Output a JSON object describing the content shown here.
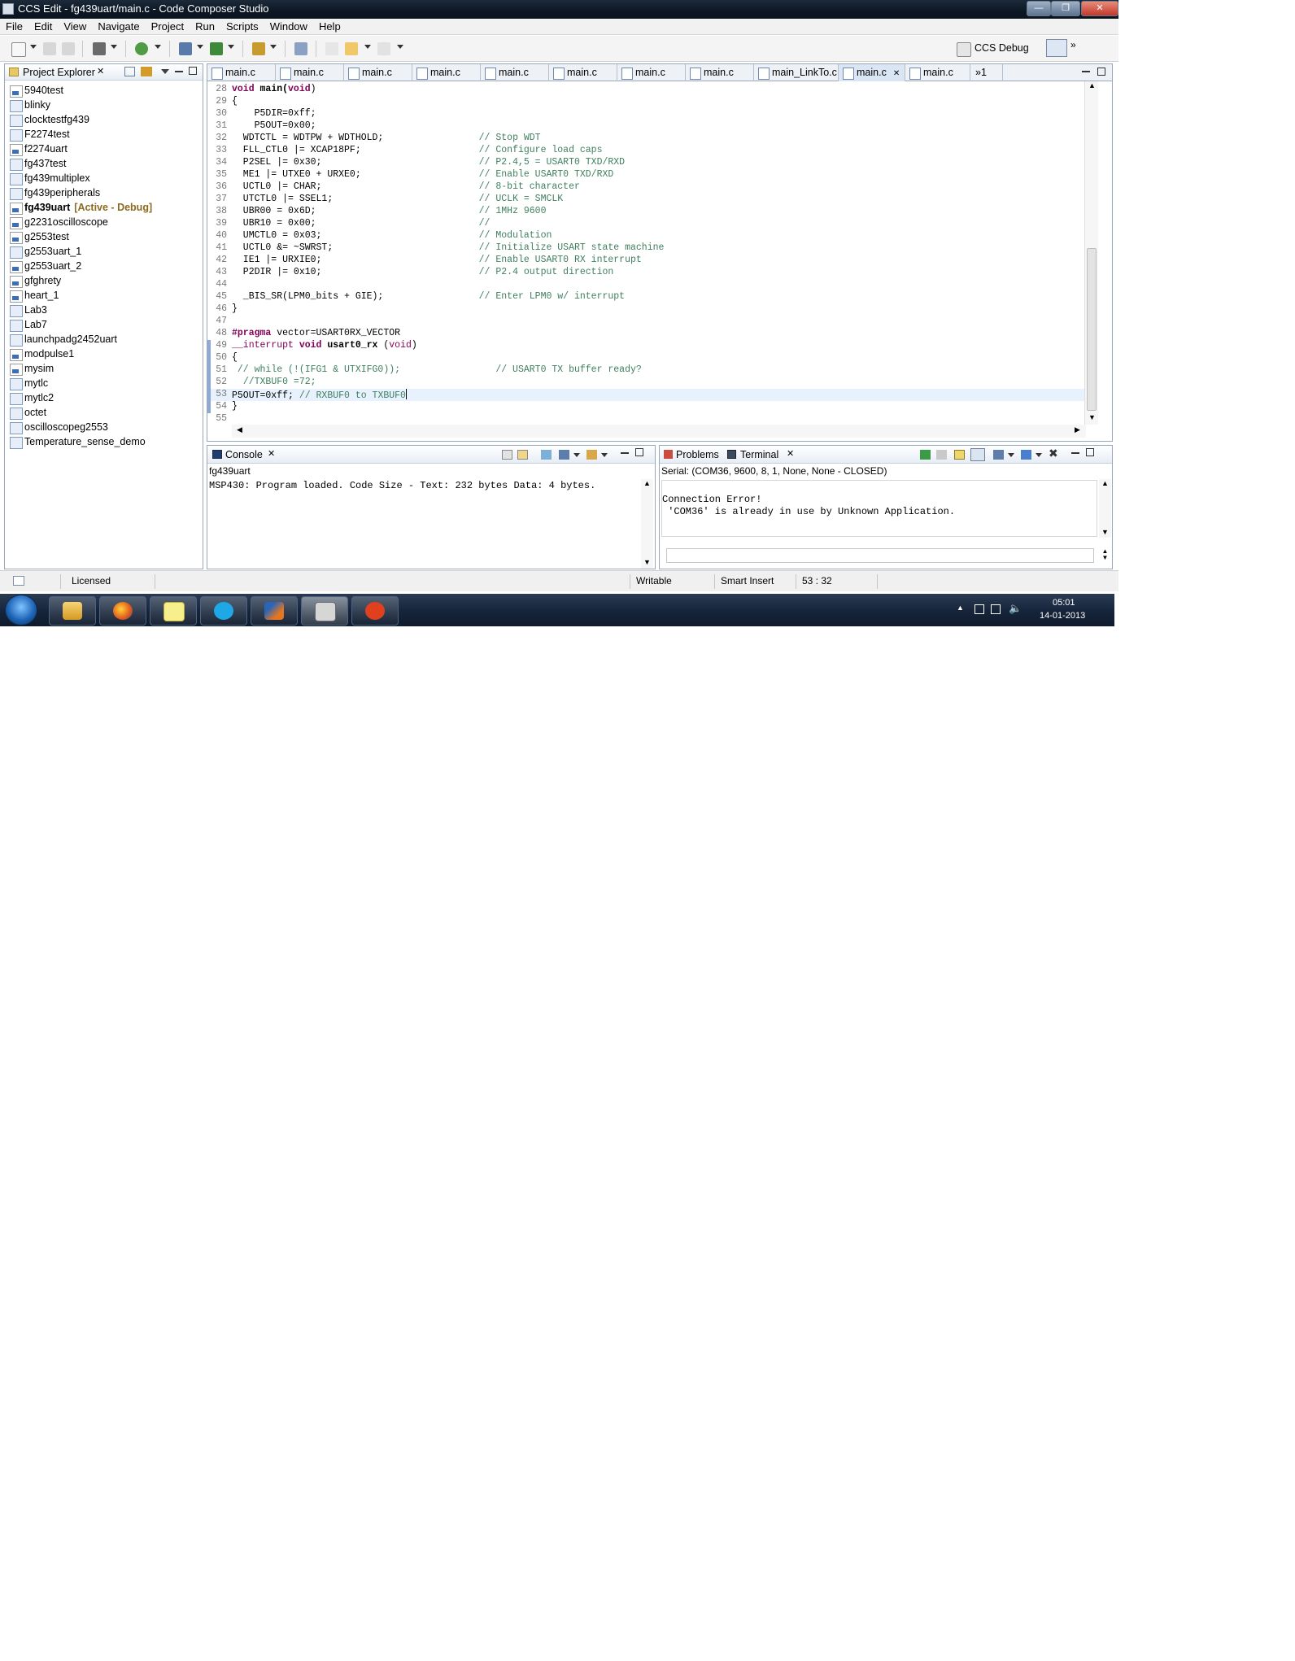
{
  "window": {
    "title": "CCS Edit - fg439uart/main.c - Code Composer Studio",
    "controls": [
      "minimize",
      "maximize",
      "close"
    ]
  },
  "menu": [
    "File",
    "Edit",
    "View",
    "Navigate",
    "Project",
    "Run",
    "Scripts",
    "Window",
    "Help"
  ],
  "perspective": {
    "label": "CCS Debug"
  },
  "project_explorer": {
    "title": "Project Explorer",
    "items": [
      {
        "name": "5940test",
        "ccs": true
      },
      {
        "name": "blinky",
        "ccs": false
      },
      {
        "name": "clocktestfg439",
        "ccs": false
      },
      {
        "name": "F2274test",
        "ccs": false
      },
      {
        "name": "f2274uart",
        "ccs": true
      },
      {
        "name": "fg437test",
        "ccs": false
      },
      {
        "name": "fg439multiplex",
        "ccs": false
      },
      {
        "name": "fg439peripherals",
        "ccs": false
      },
      {
        "name": "fg439uart",
        "ccs": true,
        "active": true,
        "suffix": "[Active - Debug]"
      },
      {
        "name": "g2231oscilloscope",
        "ccs": true
      },
      {
        "name": "g2553test",
        "ccs": true
      },
      {
        "name": "g2553uart_1",
        "ccs": false
      },
      {
        "name": "g2553uart_2",
        "ccs": true
      },
      {
        "name": "gfghrety",
        "ccs": true
      },
      {
        "name": "heart_1",
        "ccs": true
      },
      {
        "name": "Lab3",
        "ccs": false
      },
      {
        "name": "Lab7",
        "ccs": false
      },
      {
        "name": "launchpadg2452uart",
        "ccs": false
      },
      {
        "name": "modpulse1",
        "ccs": true
      },
      {
        "name": "mysim",
        "ccs": true
      },
      {
        "name": "mytlc",
        "ccs": false
      },
      {
        "name": "mytlc2",
        "ccs": false
      },
      {
        "name": "octet",
        "ccs": false
      },
      {
        "name": "oscilloscopeg2553",
        "ccs": false
      },
      {
        "name": "Temperature_sense_demo",
        "ccs": false
      }
    ]
  },
  "editor": {
    "tabs": [
      "main.c",
      "main.c",
      "main.c",
      "main.c",
      "main.c",
      "main.c",
      "main.c",
      "main.c",
      "main_LinkTo.c",
      "main.c",
      "main.c",
      "»1"
    ],
    "active_tab_index": 9,
    "lines": [
      {
        "n": "28",
        "parts": [
          {
            "t": "void",
            "c": "kw"
          },
          {
            "t": " "
          },
          {
            "t": "main(",
            "c": "b"
          },
          {
            "t": "void",
            "c": "kw"
          },
          {
            "t": ")"
          }
        ]
      },
      {
        "n": "29",
        "parts": [
          {
            "t": "{"
          }
        ]
      },
      {
        "n": "30",
        "parts": [
          {
            "t": "    P5DIR=0xff;"
          }
        ]
      },
      {
        "n": "31",
        "parts": [
          {
            "t": "    P5OUT=0x00;"
          }
        ]
      },
      {
        "n": "32",
        "parts": [
          {
            "t": "  WDTCTL = WDTPW + WDTHOLD;                 "
          },
          {
            "t": "// Stop WDT",
            "c": "cm"
          }
        ]
      },
      {
        "n": "33",
        "parts": [
          {
            "t": "  FLL_CTL0 |= XCAP18PF;                     "
          },
          {
            "t": "// Configure load caps",
            "c": "cm"
          }
        ]
      },
      {
        "n": "34",
        "parts": [
          {
            "t": "  P2SEL |= 0x30;                            "
          },
          {
            "t": "// P2.4,5 = USART0 TXD/RXD",
            "c": "cm"
          }
        ]
      },
      {
        "n": "35",
        "parts": [
          {
            "t": "  ME1 |= UTXE0 + URXE0;                     "
          },
          {
            "t": "// Enable USART0 TXD/RXD",
            "c": "cm"
          }
        ]
      },
      {
        "n": "36",
        "parts": [
          {
            "t": "  UCTL0 |= CHAR;                            "
          },
          {
            "t": "// 8-bit character",
            "c": "cm"
          }
        ]
      },
      {
        "n": "37",
        "parts": [
          {
            "t": "  UTCTL0 |= SSEL1;                          "
          },
          {
            "t": "// UCLK = SMCLK",
            "c": "cm"
          }
        ]
      },
      {
        "n": "38",
        "parts": [
          {
            "t": "  UBR00 = 0x6D;                             "
          },
          {
            "t": "// 1MHz 9600",
            "c": "cm"
          }
        ]
      },
      {
        "n": "39",
        "parts": [
          {
            "t": "  UBR10 = 0x00;                             "
          },
          {
            "t": "//",
            "c": "cm"
          }
        ]
      },
      {
        "n": "40",
        "parts": [
          {
            "t": "  UMCTL0 = 0x03;                            "
          },
          {
            "t": "// Modulation",
            "c": "cm"
          }
        ]
      },
      {
        "n": "41",
        "parts": [
          {
            "t": "  UCTL0 &= ~SWRST;                          "
          },
          {
            "t": "// Initialize USART state machine",
            "c": "cm"
          }
        ]
      },
      {
        "n": "42",
        "parts": [
          {
            "t": "  IE1 |= URXIE0;                            "
          },
          {
            "t": "// Enable USART0 RX interrupt",
            "c": "cm"
          }
        ]
      },
      {
        "n": "43",
        "parts": [
          {
            "t": "  P2DIR |= 0x10;                            "
          },
          {
            "t": "// P2.4 output direction",
            "c": "cm"
          }
        ]
      },
      {
        "n": "44",
        "parts": [
          {
            "t": ""
          }
        ]
      },
      {
        "n": "45",
        "parts": [
          {
            "t": "  _BIS_SR(LPM0_bits + GIE);                 "
          },
          {
            "t": "// Enter LPM0 w/ interrupt",
            "c": "cm"
          }
        ]
      },
      {
        "n": "46",
        "parts": [
          {
            "t": "}"
          }
        ]
      },
      {
        "n": "47",
        "parts": [
          {
            "t": ""
          }
        ]
      },
      {
        "n": "48",
        "parts": [
          {
            "t": "#pragma",
            "c": "kw"
          },
          {
            "t": " vector=USART0RX_VECTOR"
          }
        ]
      },
      {
        "n": "49",
        "parts": [
          {
            "t": "__interrupt",
            "c": "pp"
          },
          {
            "t": " "
          },
          {
            "t": "void",
            "c": "kw"
          },
          {
            "t": " "
          },
          {
            "t": "usart0_rx",
            "c": "b"
          },
          {
            "t": " ("
          },
          {
            "t": "void",
            "c": "pp"
          },
          {
            "t": ")"
          }
        ]
      },
      {
        "n": "50",
        "parts": [
          {
            "t": "{"
          }
        ]
      },
      {
        "n": "51",
        "parts": [
          {
            "t": " "
          },
          {
            "t": "// while (!(IFG1 & UTXIFG0));                 // USART0 TX buffer ready?",
            "c": "cm"
          }
        ]
      },
      {
        "n": "52",
        "parts": [
          {
            "t": "  "
          },
          {
            "t": "//TXBUF0 =72;",
            "c": "cm"
          }
        ]
      },
      {
        "n": "53",
        "parts": [
          {
            "t": "P5OUT=0xff; "
          },
          {
            "t": "// RXBUF0 to TXBUF0",
            "c": "cm"
          }
        ]
      },
      {
        "n": "54",
        "parts": [
          {
            "t": "}"
          }
        ]
      },
      {
        "n": "55",
        "parts": [
          {
            "t": ""
          }
        ]
      }
    ],
    "current_line_index": 25
  },
  "console": {
    "tab": "Console",
    "subtitle": "fg439uart",
    "text": "MSP430: Program loaded. Code Size - Text: 232 bytes Data: 4 bytes."
  },
  "terminal": {
    "tabs": [
      "Problems",
      "Terminal"
    ],
    "status": "Serial: (COM36, 9600, 8, 1, None, None - CLOSED)",
    "line1": "Connection Error!",
    "line2": " 'COM36' is already in use by Unknown Application."
  },
  "statusbar": {
    "license": "Licensed",
    "mode": "Writable",
    "insert": "Smart Insert",
    "position": "53 : 32"
  },
  "taskbar": {
    "apps": [
      "explorer-icon",
      "firefox-icon",
      "sticky-notes-icon",
      "skype-icon",
      "matlab-icon",
      "virtualbox-icon",
      "miro-icon"
    ],
    "time": "05:01",
    "date": "14-01-2013"
  }
}
